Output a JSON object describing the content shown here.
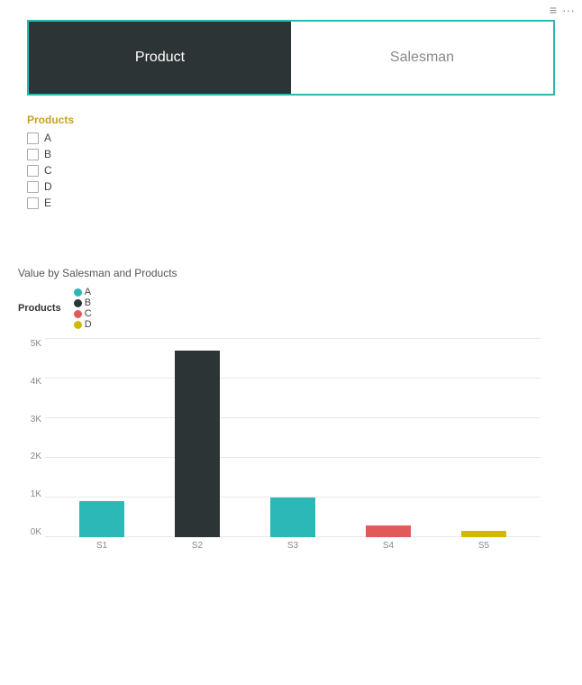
{
  "topbar": {
    "minimize_icon": "≡",
    "more_icon": "···"
  },
  "tabs": [
    {
      "id": "product",
      "label": "Product",
      "active": true
    },
    {
      "id": "salesman",
      "label": "Salesman",
      "active": false
    }
  ],
  "filter": {
    "title": "Products",
    "items": [
      {
        "label": "A",
        "checked": false
      },
      {
        "label": "B",
        "checked": false
      },
      {
        "label": "C",
        "checked": false
      },
      {
        "label": "D",
        "checked": false
      },
      {
        "label": "E",
        "checked": false
      }
    ]
  },
  "chart": {
    "title": "Value by Salesman and Products",
    "legend_title": "Products",
    "legend_items": [
      {
        "label": "A",
        "color": "#2db8b8"
      },
      {
        "label": "B",
        "color": "#2d3435"
      },
      {
        "label": "C",
        "color": "#e05a5a"
      },
      {
        "label": "D",
        "color": "#d4b800"
      }
    ],
    "y_labels": [
      "0K",
      "1K",
      "2K",
      "3K",
      "4K",
      "5K"
    ],
    "bars": [
      {
        "salesman": "S1",
        "height_pct": 18,
        "color": "#2db8b8"
      },
      {
        "salesman": "S2",
        "height_pct": 94,
        "color": "#2d3435"
      },
      {
        "salesman": "S3",
        "height_pct": 20,
        "color": "#2db8b8"
      },
      {
        "salesman": "S4",
        "height_pct": 6,
        "color": "#e05a5a"
      },
      {
        "salesman": "S5",
        "height_pct": 3,
        "color": "#d4b800"
      }
    ]
  }
}
